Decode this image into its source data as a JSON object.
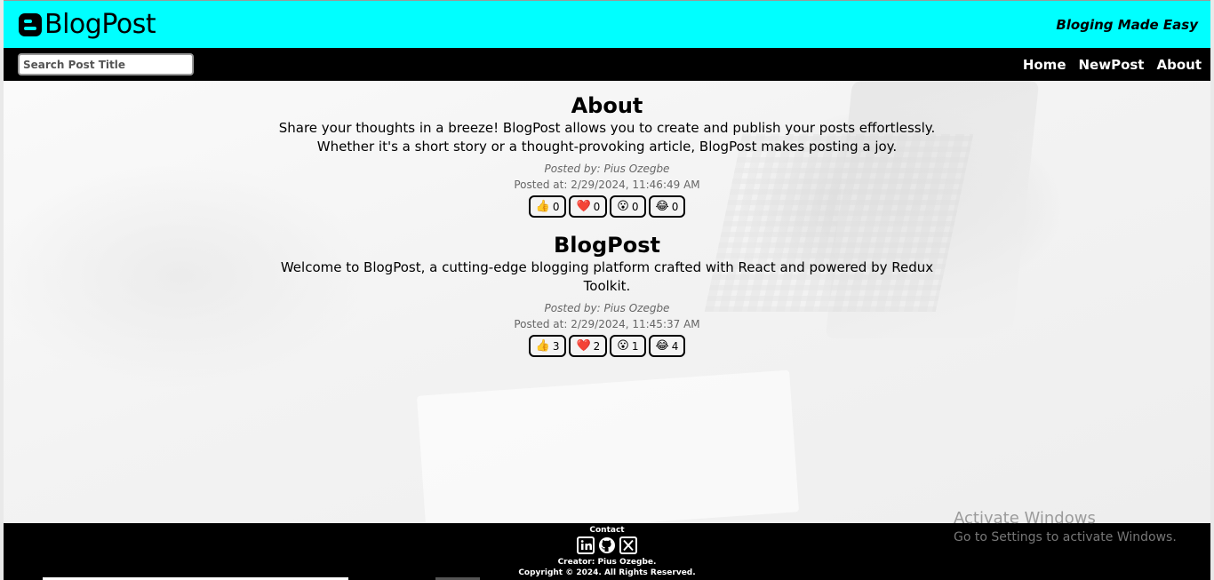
{
  "header": {
    "brand": "BlogPost",
    "brand_icon": "blogger-icon",
    "tagline": "Bloging Made Easy",
    "bg_color": "#00ffff"
  },
  "nav": {
    "search_placeholder": "Search Post Title",
    "links": [
      "Home",
      "NewPost",
      "About"
    ]
  },
  "posts": [
    {
      "title": "About",
      "body": "Share your thoughts in a breeze! BlogPost allows you to create and publish your posts effortlessly. Whether it's a short story or a thought-provoking article, BlogPost makes posting a joy.",
      "author": "Posted by: Pius Ozegbe",
      "date": "Posted at: 2/29/2024, 11:46:49 AM",
      "reactions": [
        {
          "icon": "thumbs-up-icon",
          "emoji": "👍",
          "count": "0"
        },
        {
          "icon": "heart-icon",
          "emoji": "❤️",
          "count": "0"
        },
        {
          "icon": "surprised-icon",
          "emoji": "😮",
          "count": "0"
        },
        {
          "icon": "laughing-icon",
          "emoji": "😂",
          "count": "0"
        }
      ]
    },
    {
      "title": "BlogPost",
      "body": "Welcome to BlogPost, a cutting-edge blogging platform crafted with React and powered by Redux Toolkit.",
      "author": "Posted by: Pius Ozegbe",
      "date": "Posted at: 2/29/2024, 11:45:37 AM",
      "reactions": [
        {
          "icon": "thumbs-up-icon",
          "emoji": "👍",
          "count": "3"
        },
        {
          "icon": "heart-icon",
          "emoji": "❤️",
          "count": "2"
        },
        {
          "icon": "surprised-icon",
          "emoji": "😮",
          "count": "1"
        },
        {
          "icon": "laughing-icon",
          "emoji": "😂",
          "count": "4"
        }
      ]
    }
  ],
  "footer": {
    "contact_title": "Contact",
    "social": [
      "linkedin-icon",
      "github-icon",
      "x-icon"
    ],
    "creator": "Creator: Pius Ozegbe.",
    "copyright": "Copyright © 2024. All Rights Reserved."
  },
  "watermark": {
    "title": "Activate Windows",
    "subtitle": "Go to Settings to activate Windows."
  }
}
